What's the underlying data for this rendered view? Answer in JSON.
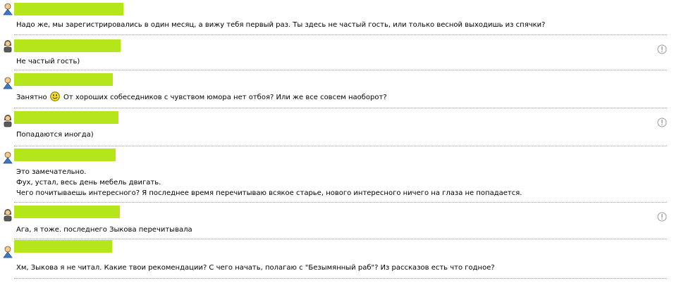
{
  "messages": [
    {
      "sender": "user-male",
      "lines": [
        "Надо же, мы зарегистрировались в один месяц, а вижу тебя первый раз. Ты здесь не частый гость, или только весной выходишь из спячки?"
      ],
      "report": false
    },
    {
      "sender": "user-female",
      "lines": [
        "Не частый гость)"
      ],
      "report": true
    },
    {
      "sender": "user-male",
      "lines": [
        "Занятно",
        "От хороших собеседников с чувством юмора нет отбоя? Или же все совсем наоборот?"
      ],
      "emoji": "smile-emoticon",
      "report": false
    },
    {
      "sender": "user-female",
      "lines": [
        "Попадаются иногда)"
      ],
      "report": true
    },
    {
      "sender": "user-male",
      "lines": [
        "Это замечательно.",
        "Фух, устал, весь день мебель двигать.",
        "Чего почитываешь интересного? Я последнее время перечитываю всякое старье, нового интересного ничего на глаза не попадается."
      ],
      "report": false
    },
    {
      "sender": "user-female",
      "lines": [
        "Ага, я тоже. последнего Зыкова перечитывала"
      ],
      "report": true
    },
    {
      "sender": "user-male",
      "lines": [
        "Хм, Зыкова я не читал. Какие твои рекомендации? С чего начать, полагаю с \"Безымянный раб\"? Из рассказов есть что годное?"
      ],
      "report": false
    }
  ],
  "colors": {
    "name_highlight": "#b4e61b",
    "separator": "#9a9a9a"
  },
  "icons": {
    "male_avatar": "male-user-icon",
    "female_avatar": "female-user-icon",
    "report": "exclamation-circle-icon"
  }
}
